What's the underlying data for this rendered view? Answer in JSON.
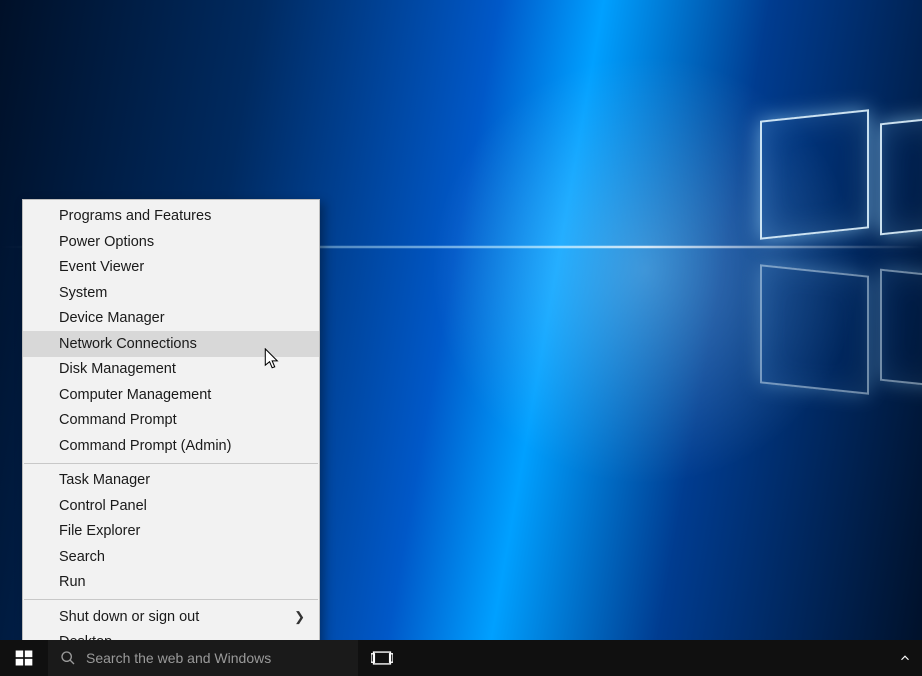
{
  "context_menu": {
    "groups": [
      [
        {
          "id": "programs-and-features",
          "label": "Programs and Features"
        },
        {
          "id": "power-options",
          "label": "Power Options"
        },
        {
          "id": "event-viewer",
          "label": "Event Viewer"
        },
        {
          "id": "system",
          "label": "System"
        },
        {
          "id": "device-manager",
          "label": "Device Manager"
        },
        {
          "id": "network-connections",
          "label": "Network Connections",
          "hovered": true
        },
        {
          "id": "disk-management",
          "label": "Disk Management"
        },
        {
          "id": "computer-management",
          "label": "Computer Management"
        },
        {
          "id": "command-prompt",
          "label": "Command Prompt"
        },
        {
          "id": "command-prompt-admin",
          "label": "Command Prompt (Admin)"
        }
      ],
      [
        {
          "id": "task-manager",
          "label": "Task Manager"
        },
        {
          "id": "control-panel",
          "label": "Control Panel"
        },
        {
          "id": "file-explorer",
          "label": "File Explorer"
        },
        {
          "id": "search",
          "label": "Search"
        },
        {
          "id": "run",
          "label": "Run"
        }
      ],
      [
        {
          "id": "shut-down-or-sign-out",
          "label": "Shut down or sign out",
          "submenu": true
        },
        {
          "id": "desktop",
          "label": "Desktop"
        }
      ]
    ]
  },
  "taskbar": {
    "search_placeholder": "Search the web and Windows"
  }
}
